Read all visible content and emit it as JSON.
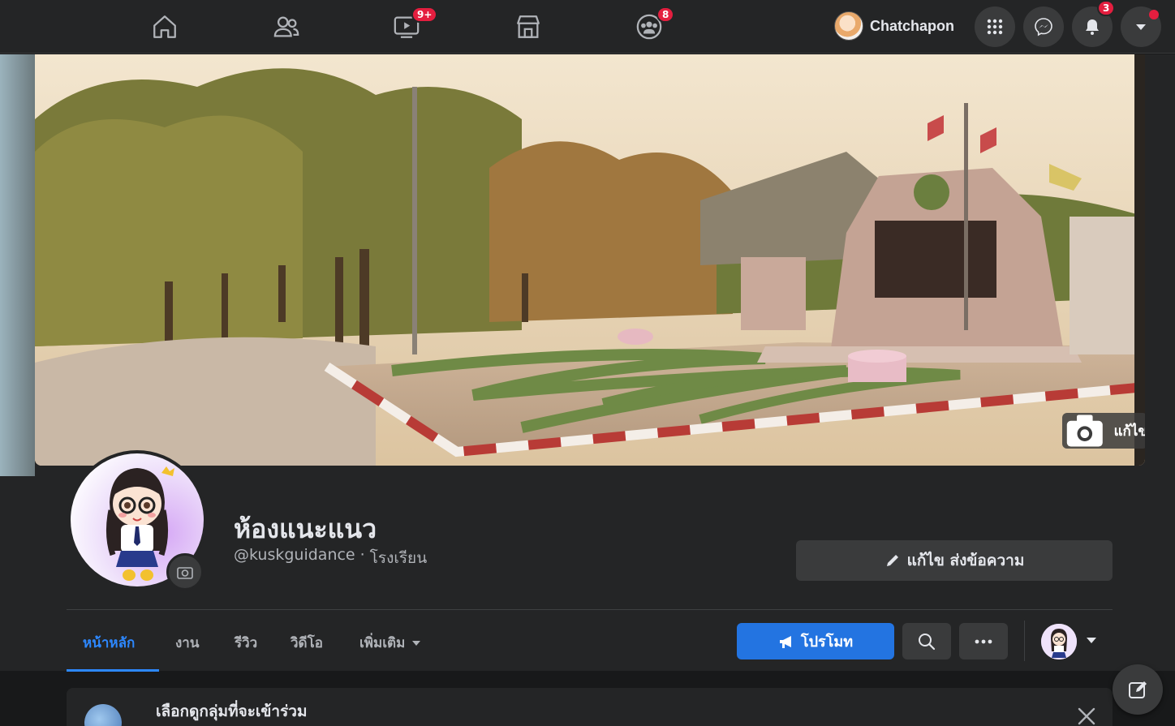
{
  "topnav": {
    "watch_badge": "9+",
    "groups_badge": "8",
    "user_name": "Chatchapon",
    "notifications_badge": "3"
  },
  "cover": {
    "edit_label": "แก้ไข"
  },
  "page": {
    "name": "ห้องแนะแนว",
    "handle": "@kuskguidance",
    "separator": "·",
    "category": "โรงเรียน"
  },
  "actions": {
    "edit_send_label": "แก้ไข ส่งข้อความ",
    "promote_label": "โปรโมท"
  },
  "tabs": [
    {
      "label": "หน้าหลัก"
    },
    {
      "label": "งาน"
    },
    {
      "label": "รีวิว"
    },
    {
      "label": "วิดีโอ"
    },
    {
      "label": "เพิ่มเติม"
    }
  ],
  "card": {
    "title": "เลือกดูกลุ่มที่จะเข้าร่วม"
  },
  "colors": {
    "accent": "#2d88ff",
    "promote": "#2374e1",
    "badge": "#e41e3f"
  }
}
